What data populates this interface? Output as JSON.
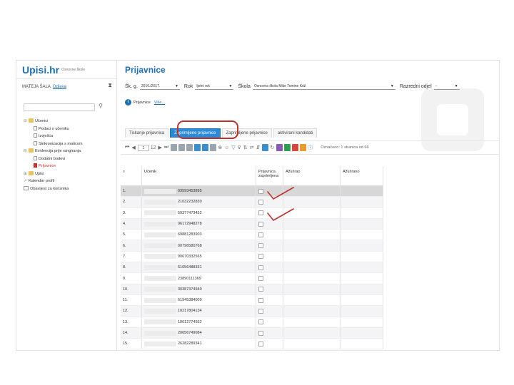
{
  "app": {
    "logo": "Upisi.hr",
    "logo_sub": "Osnovne škole"
  },
  "user": {
    "name": "MATEJA ŠALA",
    "logout": "Odjava",
    "collapse_icon": "collapse-icon"
  },
  "tree": {
    "items": [
      {
        "label": "Učenici",
        "level": 0,
        "kind": "folder"
      },
      {
        "label": "Podaci o učeniku",
        "level": 1,
        "kind": "doc"
      },
      {
        "label": "Izvješća",
        "level": 1,
        "kind": "doc"
      },
      {
        "label": "Sinkronizacija s maticom",
        "level": 1,
        "kind": "doc"
      },
      {
        "label": "Evidencija prije rangiranja",
        "level": 0,
        "kind": "folder"
      },
      {
        "label": "Dodatni bodovi",
        "level": 1,
        "kind": "doc"
      },
      {
        "label": "Prijavnice",
        "level": 1,
        "kind": "doc-red"
      },
      {
        "label": "Upisi",
        "level": 0,
        "kind": "folder"
      },
      {
        "label": "Kalendar profil",
        "level": 0,
        "kind": "link"
      },
      {
        "label": "Obavijest za korisnika",
        "level": 0,
        "kind": "list"
      }
    ]
  },
  "main": {
    "title": "Prijavnice",
    "filters": {
      "sk_label": "Šk. g.",
      "sk_value": "2016./2017.",
      "rok_label": "Rok",
      "rok_value": "ljetni rok",
      "skola_label": "Škola",
      "skola_value": "Osnovna škola Mike Tomine Križ",
      "razredni_label": "Razredni odjel",
      "razredni_value": "–"
    },
    "info": {
      "text": "Prijavnice",
      "more": "Više..."
    },
    "tabs": [
      "Tiskanje prijavnica",
      "Zaprimljene prijavnice",
      "Zaprimljene prijavnice",
      "aktivirani kandidati"
    ],
    "toolbar": {
      "page": "1",
      "page_total": "12",
      "count": "Označeno: 1 stranica od 66"
    }
  },
  "grid": {
    "headers": {
      "search": "⌕",
      "ucenik": "Učenik",
      "prijavnica": "Prijavnica zaprimljena",
      "azurirao": "Ažurirao",
      "azurirano": "Ažurirano"
    },
    "rows": [
      {
        "n": "1.",
        "oib": "93593453895"
      },
      {
        "n": "2.",
        "oib": "21032232830"
      },
      {
        "n": "3.",
        "oib": "59377473452"
      },
      {
        "n": "4.",
        "oib": "06172948278"
      },
      {
        "n": "5.",
        "oib": "69881283903"
      },
      {
        "n": "6.",
        "oib": "00796580768"
      },
      {
        "n": "7.",
        "oib": "90670332565"
      },
      {
        "n": "8.",
        "oib": "51656488331"
      },
      {
        "n": "9.",
        "oib": "23890111369"
      },
      {
        "n": "10.",
        "oib": "30387374940"
      },
      {
        "n": "11.",
        "oib": "61945384009"
      },
      {
        "n": "12.",
        "oib": "10217804134"
      },
      {
        "n": "13.",
        "oib": "18012774932"
      },
      {
        "n": "14.",
        "oib": "20656749084"
      },
      {
        "n": "15.",
        "oib": "26282289341"
      }
    ]
  },
  "colors": {
    "accent": "#1c6fb3",
    "tab_selected": "#2a8ad6",
    "annotation": "#c0302a"
  }
}
